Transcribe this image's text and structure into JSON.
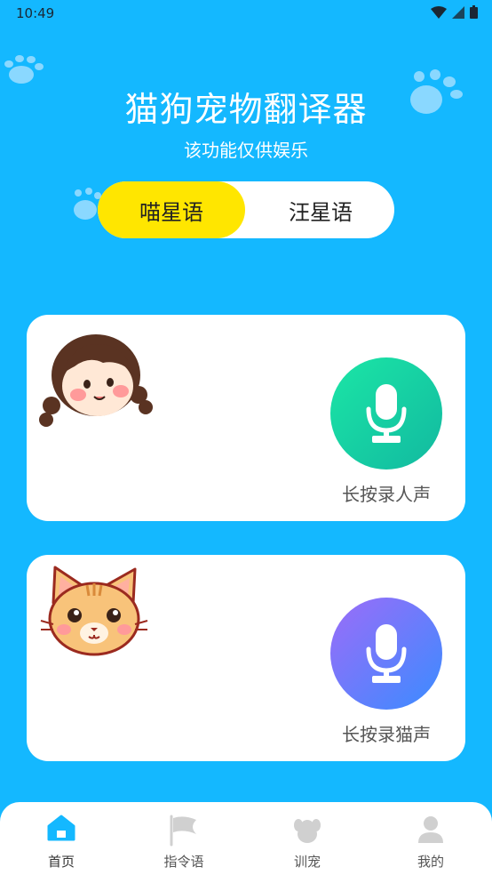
{
  "status_bar": {
    "time": "10:49"
  },
  "header": {
    "title": "猫狗宠物翻译器",
    "subtitle": "该功能仅供娱乐"
  },
  "mode_toggle": {
    "options": [
      {
        "label": "喵星语",
        "selected": true
      },
      {
        "label": "汪星语",
        "selected": false
      }
    ]
  },
  "cards": {
    "human": {
      "button_label": "长按录人声"
    },
    "cat": {
      "button_label": "长按录猫声"
    }
  },
  "bottom_nav": {
    "items": [
      {
        "label": "首页",
        "icon": "home-icon",
        "active": true
      },
      {
        "label": "指令语",
        "icon": "flag-icon",
        "active": false
      },
      {
        "label": "训宠",
        "icon": "dog-icon",
        "active": false
      },
      {
        "label": "我的",
        "icon": "user-icon",
        "active": false
      }
    ]
  },
  "colors": {
    "background": "#14b8ff",
    "toggle_selected": "#ffe600",
    "mic_human": "#1be6a6",
    "mic_cat": "#9c6cf8",
    "nav_active": "#14b8ff",
    "nav_inactive": "#d0d0d0"
  }
}
